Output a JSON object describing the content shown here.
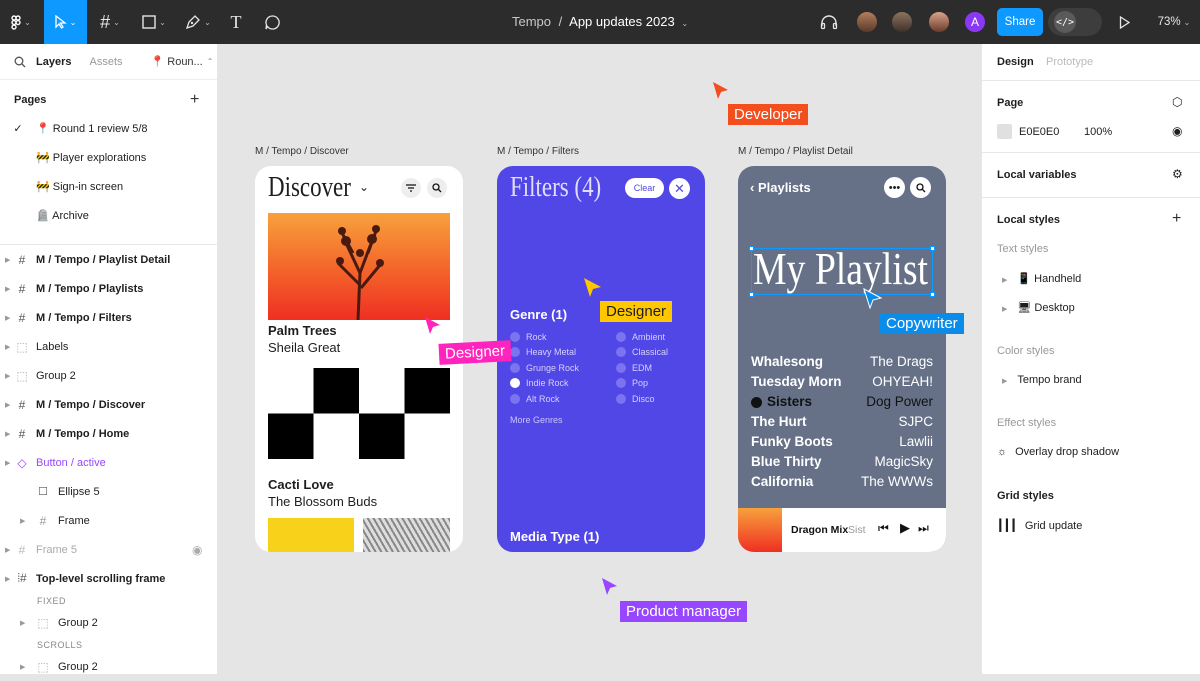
{
  "toolbar": {
    "doc_project": "Tempo",
    "doc_sep": "/",
    "doc_name": "App updates 2023",
    "share_label": "Share",
    "avatar_letter": "A",
    "zoom": "73%"
  },
  "left_panel": {
    "tabs": [
      "Layers",
      "Assets"
    ],
    "page_selector": "📍 Roun...",
    "pages_heading": "Pages",
    "pages": [
      {
        "label": "📍 Round 1 review 5/8",
        "current": true
      },
      {
        "label": "🚧 Player explorations",
        "current": false
      },
      {
        "label": "🚧 Sign-in screen",
        "current": false
      },
      {
        "label": "🪦 Archive",
        "current": false
      }
    ],
    "layers": [
      {
        "label": "M / Tempo / Playlist Detail"
      },
      {
        "label": "M / Tempo / Playlists"
      },
      {
        "label": "M / Tempo / Filters"
      },
      {
        "label": "Labels"
      },
      {
        "label": "Group 2"
      },
      {
        "label": "M / Tempo / Discover"
      },
      {
        "label": "M / Tempo / Home"
      },
      {
        "label": "Button / active"
      },
      {
        "label": "Ellipse 5"
      },
      {
        "label": "Frame"
      },
      {
        "label": "Frame 5"
      },
      {
        "label": "Top-level scrolling frame"
      },
      {
        "label": "FIXED"
      },
      {
        "label": "Group 2"
      },
      {
        "label": "SCROLLS"
      },
      {
        "label": "Group 2"
      }
    ]
  },
  "canvas": {
    "frames": {
      "discover": {
        "title": "M / Tempo / Discover",
        "heading": "Discover",
        "card1_title": "Palm Trees",
        "card1_artist": "Sheila Great",
        "card2_title": "Cacti Love",
        "card2_artist": "The Blossom Buds"
      },
      "filters": {
        "title": "M / Tempo / Filters",
        "heading": "Filters (4)",
        "clear": "Clear",
        "genre_heading": "Genre (1)",
        "genres_left": [
          "Rock",
          "Heavy Metal",
          "Grunge Rock",
          "Indie Rock",
          "Alt Rock"
        ],
        "genres_right": [
          "Ambient",
          "Classical",
          "EDM",
          "Pop",
          "Disco"
        ],
        "more": "More Genres",
        "media": "Media Type (1)"
      },
      "playlist": {
        "title": "M / Tempo / Playlist Detail",
        "back": "Playlists",
        "heading": "My Playlist",
        "tracks": [
          {
            "song": "Whalesong",
            "artist": "The Drags"
          },
          {
            "song": "Tuesday Morn",
            "artist": "OHYEAH!"
          },
          {
            "song": "Sisters",
            "artist": "Dog Power"
          },
          {
            "song": "The Hurt",
            "artist": "SJPC"
          },
          {
            "song": "Funky Boots",
            "artist": "Lawlii"
          },
          {
            "song": "Blue Thirty",
            "artist": "MagicSky"
          },
          {
            "song": "California",
            "artist": "The WWWs"
          }
        ],
        "now_playing": "Dragon Mix",
        "now_playing_artist": "Sist"
      }
    },
    "cursors": {
      "developer": "Developer",
      "designer_pink": "Designer",
      "designer_yellow": "Designer",
      "copywriter": "Copywriter",
      "product_manager": "Product manager"
    }
  },
  "right_panel": {
    "tabs": [
      "Design",
      "Prototype"
    ],
    "page_heading": "Page",
    "page_color": "E0E0E0",
    "page_opacity": "100%",
    "local_variables": "Local variables",
    "local_styles": "Local styles",
    "text_styles_heading": "Text styles",
    "text_styles": [
      "Handheld",
      "Desktop"
    ],
    "color_styles_heading": "Color styles",
    "color_styles": [
      "Tempo brand"
    ],
    "effect_styles_heading": "Effect styles",
    "effect_styles": [
      "Overlay drop shadow"
    ],
    "grid_styles_heading": "Grid styles",
    "grid_styles": [
      "Grid update"
    ]
  },
  "colors": {
    "toolbar_bg": "#2c2c2c",
    "accent_blue": "#0d99ff",
    "filters_bg": "#5146e6",
    "playlist_bg": "#667188",
    "cursor_developer": "#f24e1e",
    "cursor_designer_pink": "#ff24bd",
    "cursor_designer_yellow": "#ffc700",
    "cursor_copywriter": "#0c8ce9",
    "cursor_pm": "#9747ff"
  }
}
